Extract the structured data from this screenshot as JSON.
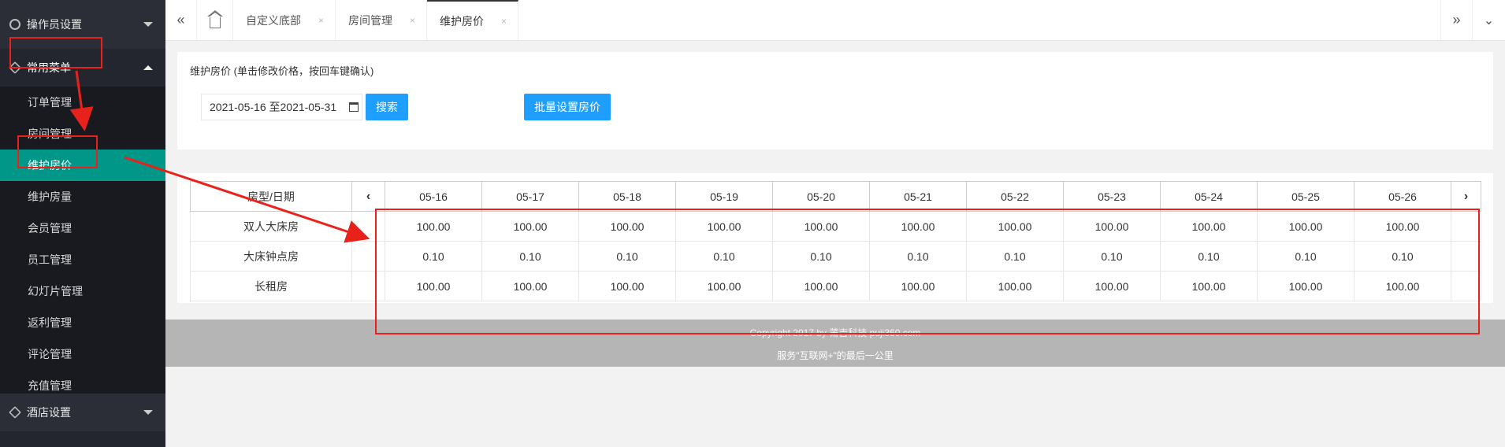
{
  "sidebar": {
    "group_operator": "操作员设置",
    "group_common": "常用菜单",
    "items": [
      "订单管理",
      "房间管理",
      "维护房价",
      "维护房量",
      "会员管理",
      "员工管理",
      "幻灯片管理",
      "返利管理",
      "评论管理",
      "充值管理"
    ],
    "group_hotel": "酒店设置"
  },
  "tabs": [
    {
      "label": "自定义底部"
    },
    {
      "label": "房间管理"
    },
    {
      "label": "维护房价"
    }
  ],
  "tab_close": "×",
  "toolbar": {
    "collapse_icon": "«",
    "more_icon": "»",
    "dropdown_icon": "⌄"
  },
  "panel": {
    "title": "维护房价 (单击修改价格，按回车键确认)",
    "date_range": "2021-05-16 至2021-05-31",
    "search_label": "搜索",
    "batch_label": "批量设置房价"
  },
  "table": {
    "corner": "房型/日期",
    "prev": "‹",
    "next": "›",
    "dates": [
      "05-16",
      "05-17",
      "05-18",
      "05-19",
      "05-20",
      "05-21",
      "05-22",
      "05-23",
      "05-24",
      "05-25",
      "05-26"
    ],
    "rows": [
      {
        "name": "双人大床房",
        "prices": [
          "100.00",
          "100.00",
          "100.00",
          "100.00",
          "100.00",
          "100.00",
          "100.00",
          "100.00",
          "100.00",
          "100.00",
          "100.00"
        ]
      },
      {
        "name": "大床钟点房",
        "prices": [
          "0.10",
          "0.10",
          "0.10",
          "0.10",
          "0.10",
          "0.10",
          "0.10",
          "0.10",
          "0.10",
          "0.10",
          "0.10"
        ]
      },
      {
        "name": "长租房",
        "prices": [
          "100.00",
          "100.00",
          "100.00",
          "100.00",
          "100.00",
          "100.00",
          "100.00",
          "100.00",
          "100.00",
          "100.00",
          "100.00"
        ]
      }
    ]
  },
  "footer": {
    "copyright": "Copyright 2017 by 莆吉科技 puji360.com",
    "slogan": "服务\"互联网+\"的最后一公里"
  },
  "colors": {
    "sidebar_bg": "#23262e",
    "active_item": "#009688",
    "button_blue": "#1e9fff",
    "annotation_red": "#e8221b"
  }
}
